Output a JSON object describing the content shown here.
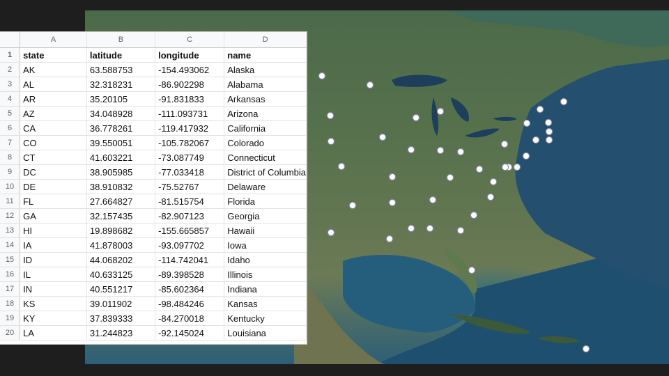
{
  "spreadsheet": {
    "column_letters": [
      "A",
      "B",
      "C",
      "D"
    ],
    "row_numbers": [
      "1",
      "2",
      "3",
      "4",
      "5",
      "6",
      "7",
      "8",
      "9",
      "10",
      "11",
      "12",
      "13",
      "14",
      "15",
      "16",
      "17",
      "18",
      "19",
      "20"
    ],
    "headers": [
      "state",
      "latitude",
      "longitude",
      "name"
    ],
    "rows": [
      [
        "AK",
        "63.588753",
        "-154.493062",
        "Alaska"
      ],
      [
        "AL",
        "32.318231",
        "-86.902298",
        "Alabama"
      ],
      [
        "AR",
        "35.20105",
        "-91.831833",
        "Arkansas"
      ],
      [
        "AZ",
        "34.048928",
        "-111.093731",
        "Arizona"
      ],
      [
        "CA",
        "36.778261",
        "-119.417932",
        "California"
      ],
      [
        "CO",
        "39.550051",
        "-105.782067",
        "Colorado"
      ],
      [
        "CT",
        "41.603221",
        "-73.087749",
        "Connecticut"
      ],
      [
        "DC",
        "38.905985",
        "-77.033418",
        "District of Columbia"
      ],
      [
        "DE",
        "38.910832",
        "-75.52767",
        "Delaware"
      ],
      [
        "FL",
        "27.664827",
        "-81.515754",
        "Florida"
      ],
      [
        "GA",
        "32.157435",
        "-82.907123",
        "Georgia"
      ],
      [
        "HI",
        "19.898682",
        "-155.665857",
        "Hawaii"
      ],
      [
        "IA",
        "41.878003",
        "-93.097702",
        "Iowa"
      ],
      [
        "ID",
        "44.068202",
        "-114.742041",
        "Idaho"
      ],
      [
        "IL",
        "40.633125",
        "-89.398528",
        "Illinois"
      ],
      [
        "IN",
        "40.551217",
        "-85.602364",
        "Indiana"
      ],
      [
        "KS",
        "39.011902",
        "-98.484246",
        "Kansas"
      ],
      [
        "KY",
        "37.839333",
        "-84.270018",
        "Kentucky"
      ],
      [
        "LA",
        "31.244823",
        "-92.145024",
        "Louisiana"
      ]
    ]
  },
  "map": {
    "style": "satellite",
    "marker_icon": "map-pin-dot-icon",
    "marker_color": "#ffffff",
    "marker_count": 40
  }
}
